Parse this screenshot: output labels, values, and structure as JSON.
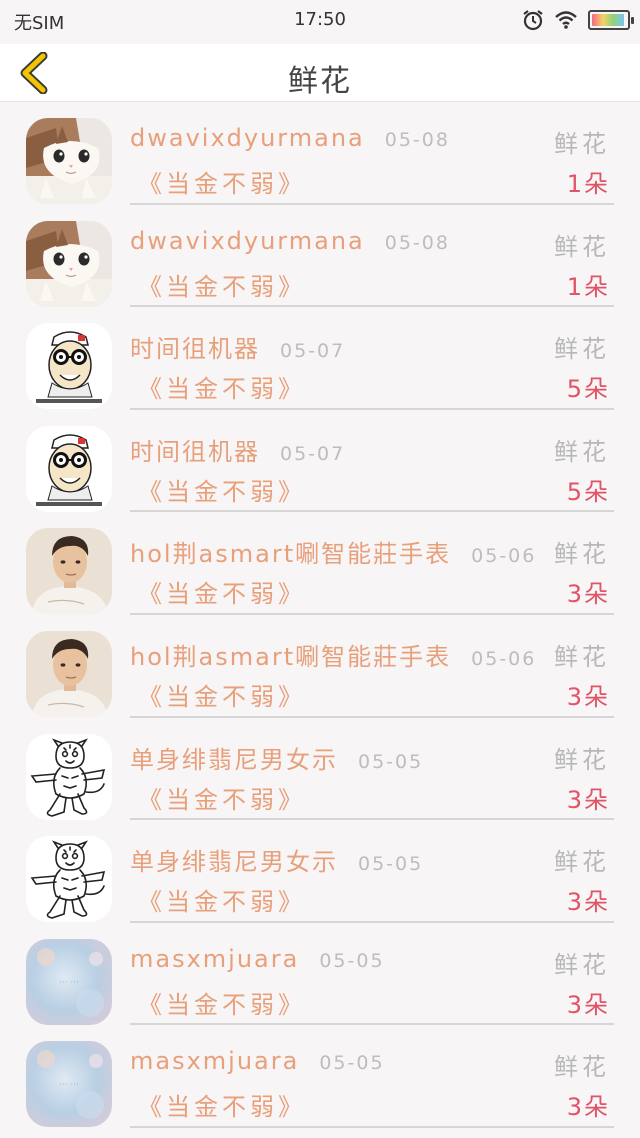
{
  "status_bar": {
    "carrier": "无SIM",
    "time": "17:50",
    "icons": [
      "alarm-icon",
      "wifi-icon",
      "battery-icon"
    ]
  },
  "nav": {
    "back_icon": "chevron-left-icon",
    "title": "鲜花"
  },
  "colors": {
    "name": "#e8a07a",
    "count": "#e05468",
    "muted": "#b8b8b8",
    "back_arrow": "#f2c500"
  },
  "items": [
    {
      "avatar": "cat-avatar",
      "sender": "dwavixdyurmana",
      "date": "05-08",
      "gift_type": "鲜花",
      "book": "《当金不弱》",
      "count": "1朵"
    },
    {
      "avatar": "cat-avatar",
      "sender": "dwavixdyurmana",
      "date": "05-08",
      "gift_type": "鲜花",
      "book": "《当金不弱》",
      "count": "1朵"
    },
    {
      "avatar": "meme-face-avatar",
      "sender": "时间徂机器",
      "date": "05-07",
      "gift_type": "鲜花",
      "book": "《当金不弱》",
      "count": "5朵"
    },
    {
      "avatar": "meme-face-avatar",
      "sender": "时间徂机器",
      "date": "05-07",
      "gift_type": "鲜花",
      "book": "《当金不弱》",
      "count": "5朵"
    },
    {
      "avatar": "young-man-avatar",
      "sender": "hol荆asmart唰智能莊手表",
      "date": "05-06",
      "gift_type": "鲜花",
      "book": "《当金不弱》",
      "count": "3朵"
    },
    {
      "avatar": "young-man-avatar",
      "sender": "hol荆asmart唰智能莊手表",
      "date": "05-06",
      "gift_type": "鲜花",
      "book": "《当金不弱》",
      "count": "3朵"
    },
    {
      "avatar": "cartoon-tiger-avatar",
      "sender": "单身绯翡尼男女示",
      "date": "05-05",
      "gift_type": "鲜花",
      "book": "《当金不弱》",
      "count": "3朵"
    },
    {
      "avatar": "cartoon-tiger-avatar",
      "sender": "单身绯翡尼男女示",
      "date": "05-05",
      "gift_type": "鲜花",
      "book": "《当金不弱》",
      "count": "3朵"
    },
    {
      "avatar": "blurry-blue-avatar",
      "sender": "masxmjuara",
      "date": "05-05",
      "gift_type": "鲜花",
      "book": "《当金不弱》",
      "count": "3朵"
    },
    {
      "avatar": "blurry-blue-avatar",
      "sender": "masxmjuara",
      "date": "05-05",
      "gift_type": "鲜花",
      "book": "《当金不弱》",
      "count": "3朵"
    }
  ]
}
